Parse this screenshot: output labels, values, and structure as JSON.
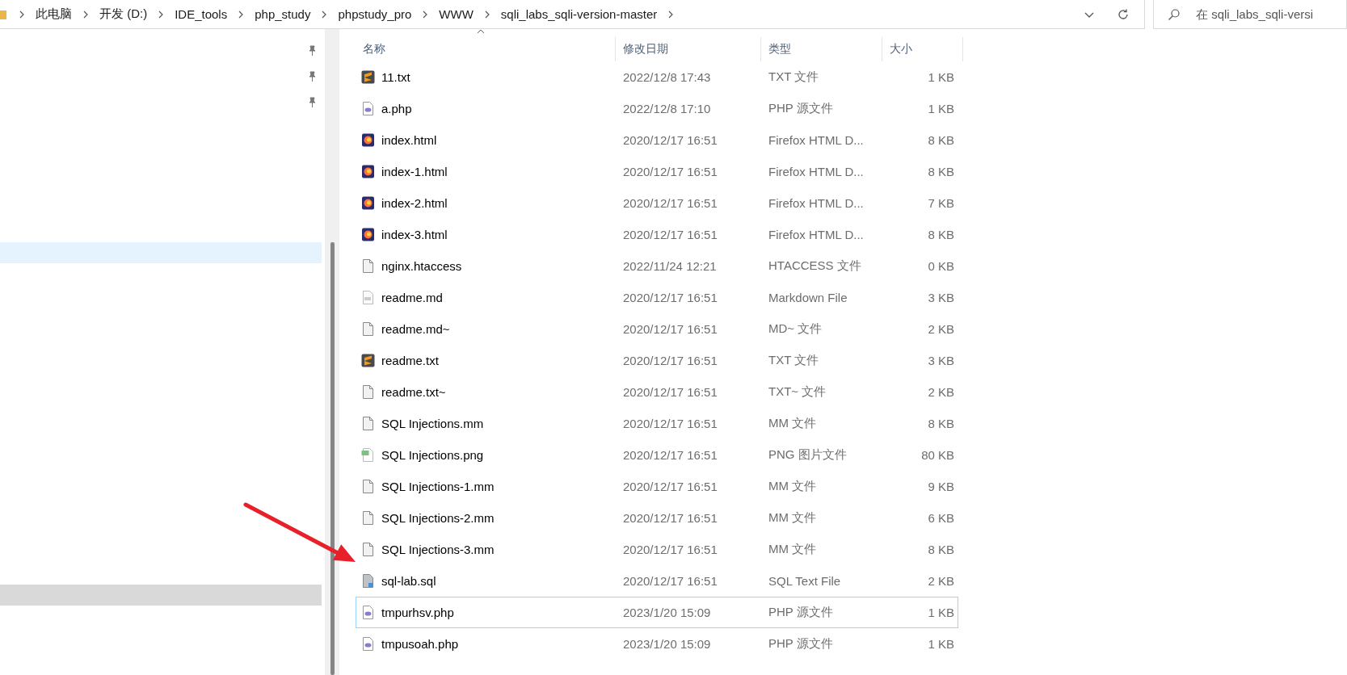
{
  "address_bar": {
    "breadcrumbs": [
      "此电脑",
      "开发 (D:)",
      "IDE_tools",
      "php_study",
      "phpstudy_pro",
      "WWW",
      "sqli_labs_sqli-version-master"
    ]
  },
  "search": {
    "placeholder": "在 sqli_labs_sqli-versi"
  },
  "nav_pane": {
    "quick_access": [
      {
        "pinned": true
      },
      {
        "pinned": true
      },
      {
        "pinned": true
      }
    ],
    "rows": [
      {
        "selected": true,
        "hovered": false
      },
      {
        "selected": false,
        "hovered": true
      }
    ]
  },
  "table": {
    "columns": [
      "名称",
      "修改日期",
      "类型",
      "大小"
    ],
    "rows": [
      {
        "kind": "sublime",
        "name": "11.txt",
        "modified": "2022/12/8 17:43",
        "type": "TXT 文件",
        "size": "1 KB",
        "selected": false
      },
      {
        "kind": "php",
        "name": "a.php",
        "modified": "2022/12/8 17:10",
        "type": "PHP 源文件",
        "size": "1 KB",
        "selected": false
      },
      {
        "kind": "firefox",
        "name": "index.html",
        "modified": "2020/12/17 16:51",
        "type": "Firefox HTML D...",
        "size": "8 KB",
        "selected": false
      },
      {
        "kind": "firefox",
        "name": "index-1.html",
        "modified": "2020/12/17 16:51",
        "type": "Firefox HTML D...",
        "size": "8 KB",
        "selected": false
      },
      {
        "kind": "firefox",
        "name": "index-2.html",
        "modified": "2020/12/17 16:51",
        "type": "Firefox HTML D...",
        "size": "7 KB",
        "selected": false
      },
      {
        "kind": "firefox",
        "name": "index-3.html",
        "modified": "2020/12/17 16:51",
        "type": "Firefox HTML D...",
        "size": "8 KB",
        "selected": false
      },
      {
        "kind": "file",
        "name": "nginx.htaccess",
        "modified": "2022/11/24 12:21",
        "type": "HTACCESS 文件",
        "size": "0 KB",
        "selected": false
      },
      {
        "kind": "markdown",
        "name": "readme.md",
        "modified": "2020/12/17 16:51",
        "type": "Markdown File",
        "size": "3 KB",
        "selected": false
      },
      {
        "kind": "file",
        "name": "readme.md~",
        "modified": "2020/12/17 16:51",
        "type": "MD~ 文件",
        "size": "2 KB",
        "selected": false
      },
      {
        "kind": "sublime",
        "name": "readme.txt",
        "modified": "2020/12/17 16:51",
        "type": "TXT 文件",
        "size": "3 KB",
        "selected": false
      },
      {
        "kind": "file",
        "name": "readme.txt~",
        "modified": "2020/12/17 16:51",
        "type": "TXT~ 文件",
        "size": "2 KB",
        "selected": false
      },
      {
        "kind": "file",
        "name": "SQL Injections.mm",
        "modified": "2020/12/17 16:51",
        "type": "MM 文件",
        "size": "8 KB",
        "selected": false
      },
      {
        "kind": "image",
        "name": "SQL Injections.png",
        "modified": "2020/12/17 16:51",
        "type": "PNG 图片文件",
        "size": "80 KB",
        "selected": false
      },
      {
        "kind": "file",
        "name": "SQL Injections-1.mm",
        "modified": "2020/12/17 16:51",
        "type": "MM 文件",
        "size": "9 KB",
        "selected": false
      },
      {
        "kind": "file",
        "name": "SQL Injections-2.mm",
        "modified": "2020/12/17 16:51",
        "type": "MM 文件",
        "size": "6 KB",
        "selected": false
      },
      {
        "kind": "file",
        "name": "SQL Injections-3.mm",
        "modified": "2020/12/17 16:51",
        "type": "MM 文件",
        "size": "8 KB",
        "selected": false
      },
      {
        "kind": "sql",
        "name": "sql-lab.sql",
        "modified": "2020/12/17 16:51",
        "type": "SQL Text File",
        "size": "2 KB",
        "selected": false
      },
      {
        "kind": "php",
        "name": "tmpurhsv.php",
        "modified": "2023/1/20 15:09",
        "type": "PHP 源文件",
        "size": "1 KB",
        "selected": true
      },
      {
        "kind": "php",
        "name": "tmpusoah.php",
        "modified": "2023/1/20 15:09",
        "type": "PHP 源文件",
        "size": "1 KB",
        "selected": false
      }
    ]
  }
}
